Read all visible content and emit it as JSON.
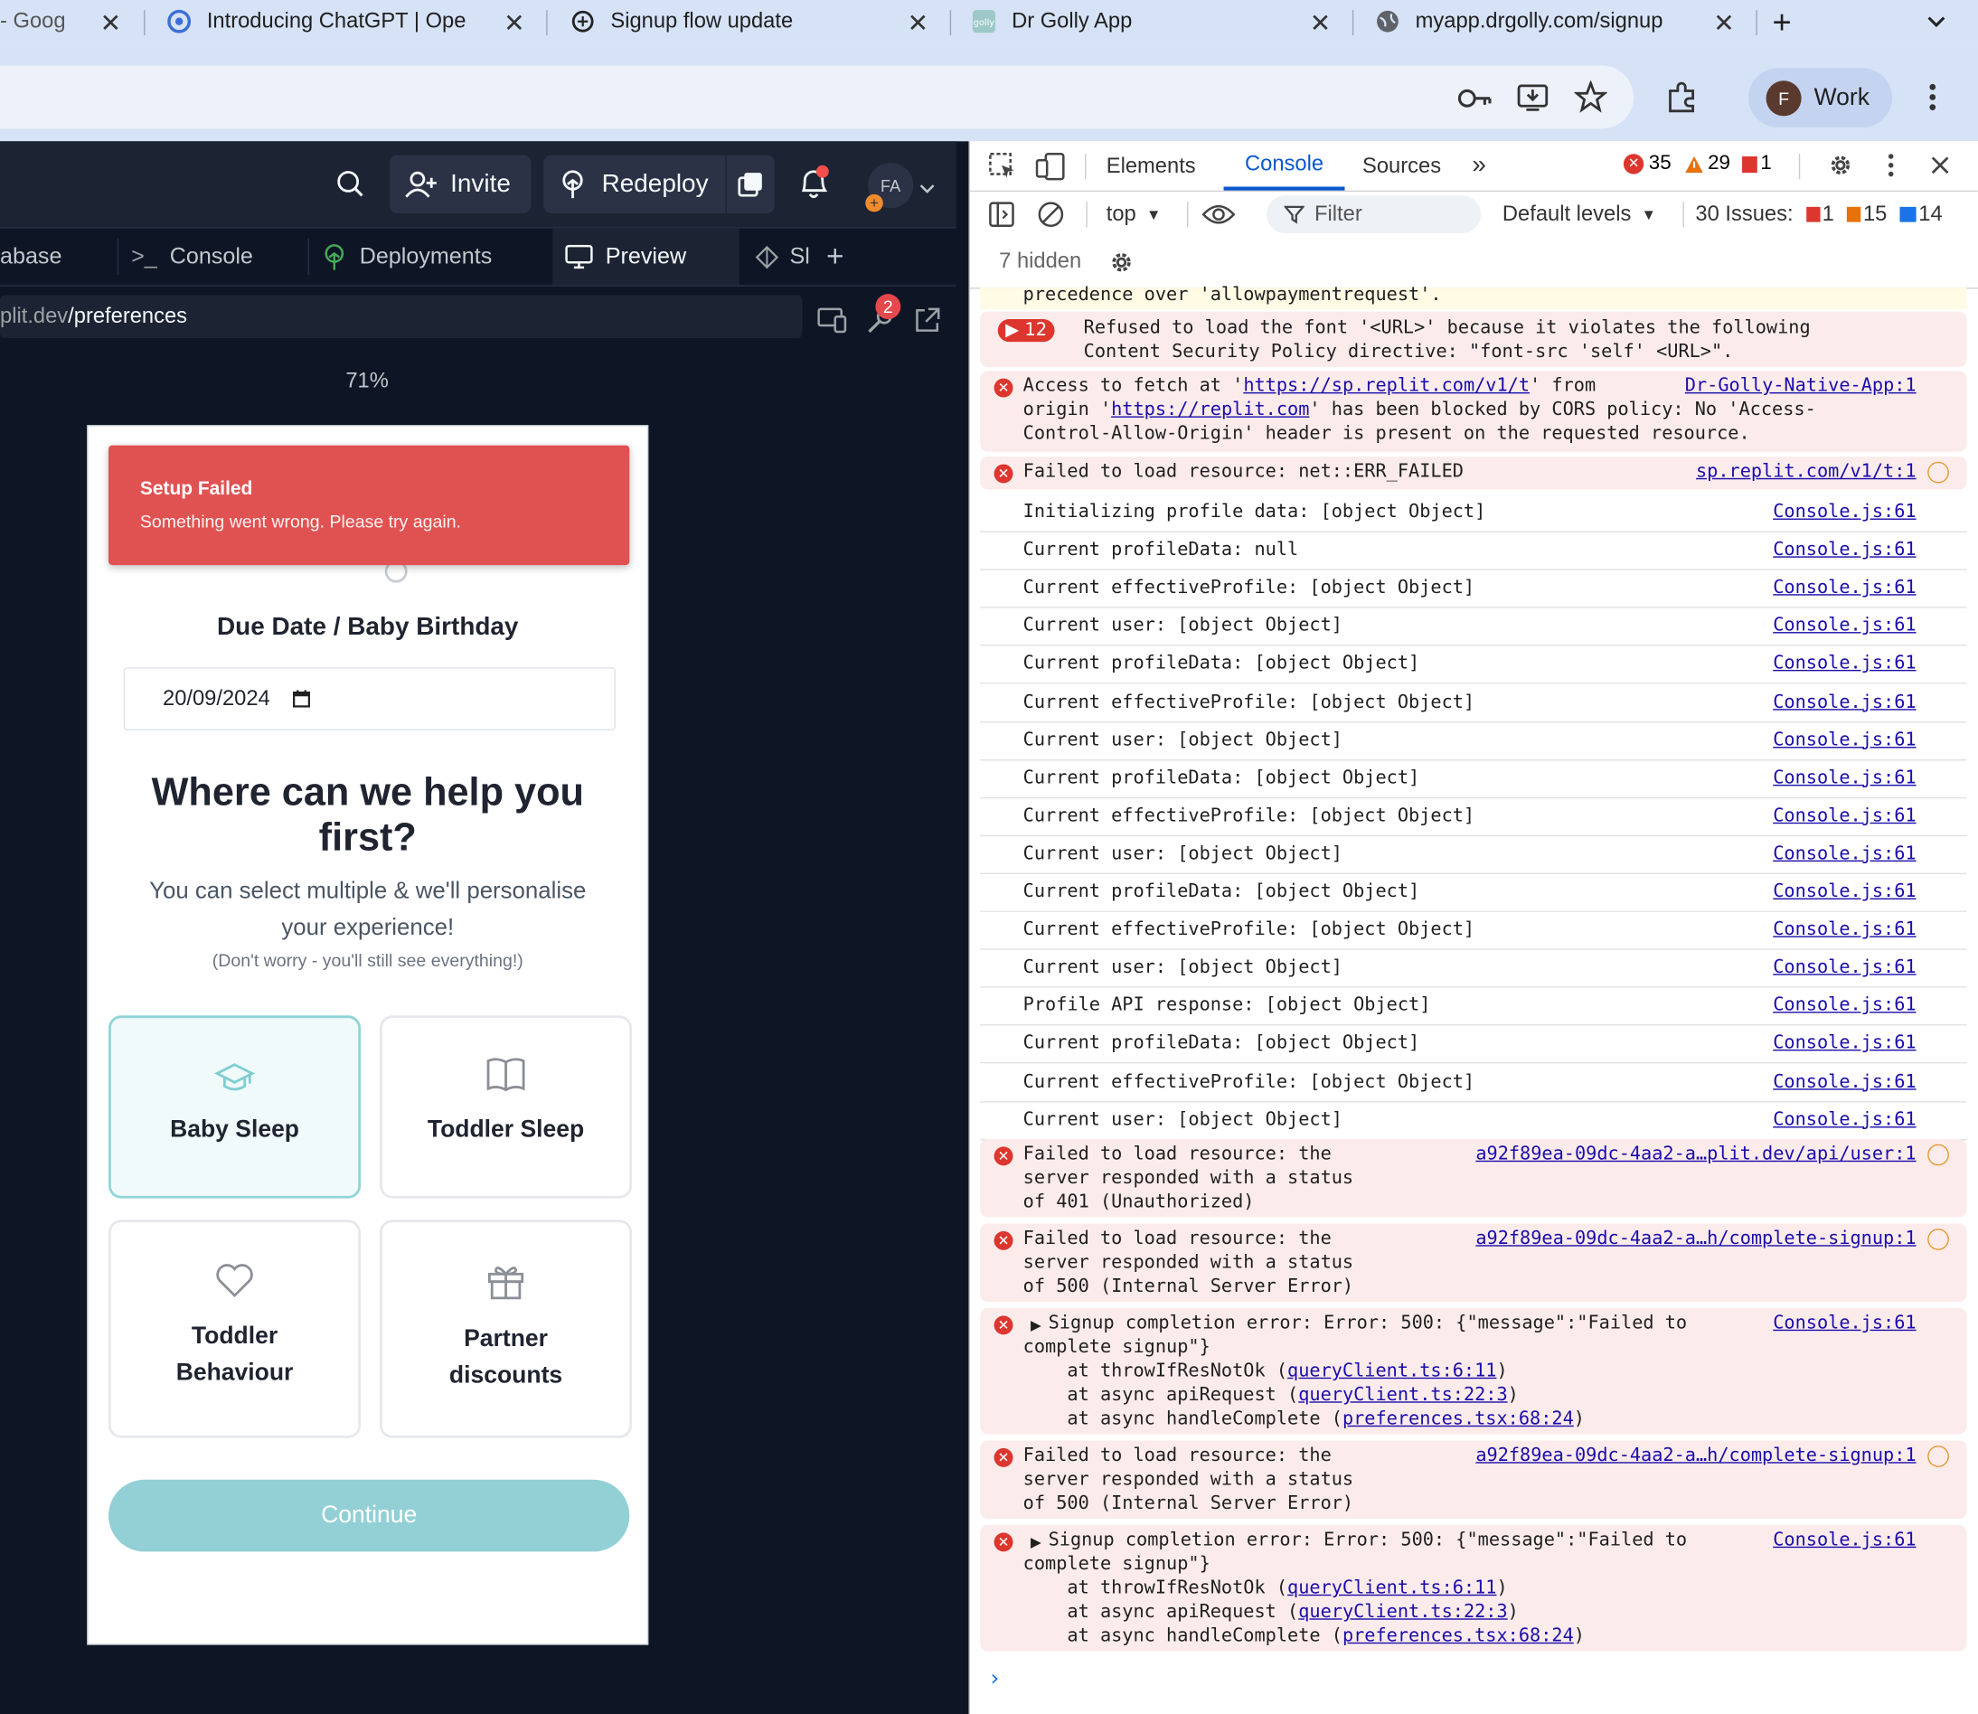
{
  "browser": {
    "tabs": [
      {
        "title": "- Goog",
        "icon": "google-icon"
      },
      {
        "title": "Introducing ChatGPT | Ope",
        "icon": "openai-icon"
      },
      {
        "title": "Signup flow update",
        "icon": "chatgpt-icon"
      },
      {
        "title": "Dr Golly App",
        "icon": "drgolly-icon"
      },
      {
        "title": "myapp.drgolly.com/signup",
        "icon": "globe-icon"
      }
    ],
    "profile": {
      "initial": "F",
      "label": "Work"
    }
  },
  "replit": {
    "header": {
      "invite": "Invite",
      "redeploy": "Redeploy",
      "avatar": "FA"
    },
    "tabs": [
      {
        "label": "abase"
      },
      {
        "label": "Console",
        "prefix": ">_"
      },
      {
        "label": "Deployments"
      },
      {
        "label": "Preview"
      },
      {
        "label": "Sl"
      }
    ],
    "url_host": "plit.dev",
    "url_path": "/preferences",
    "wrench_badge": "2",
    "zoom": "71%"
  },
  "preview": {
    "toast": {
      "title": "Setup Failed",
      "message": "Something went wrong. Please try again."
    },
    "due_label": "Due Date / Baby Birthday",
    "date_value": "20/09/2024",
    "heading_1": "Where can we help you",
    "heading_2": "first?",
    "subtitle_1": "You can select multiple & we'll personalise",
    "subtitle_2": "your experience!",
    "note": "(Don't worry - you'll still see everything!)",
    "options": [
      {
        "label": "Baby Sleep",
        "icon": "graduation-cap-icon",
        "selected": true
      },
      {
        "label": "Toddler Sleep",
        "icon": "book-icon",
        "selected": false
      },
      {
        "label_1": "Toddler",
        "label_2": "Behaviour",
        "icon": "heart-icon",
        "selected": false
      },
      {
        "label_1": "Partner",
        "label_2": "discounts",
        "icon": "gift-icon",
        "selected": false
      }
    ],
    "continue": "Continue",
    "accent": "#92d0d6",
    "error_color": "#e05252"
  },
  "devtools": {
    "tabs": [
      "Elements",
      "Console",
      "Sources"
    ],
    "errors": "35",
    "warnings": "29",
    "issues_badge": "1",
    "context": "top",
    "filter_placeholder": "Filter",
    "levels": "Default levels",
    "issues_label": "30 Issues:",
    "issues_err": "1",
    "issues_warn": "15",
    "issues_info": "14",
    "hidden": "7 hidden",
    "log": {
      "precedence": "precedence over 'allowpaymentrequest'.",
      "font_count": "12",
      "font_1": "Refused to load the font '<URL>' because it violates the following",
      "font_2": "Content Security Policy directive: \"font-src 'self' <URL>\".",
      "cors_a": "Access to fetch at '",
      "cors_url": "https://sp.replit.com/v1/t",
      "cors_b": "' from",
      "cors_src": "Dr-Golly-Native-App:1",
      "cors_c": "origin '",
      "cors_origin": "https://replit.com",
      "cors_d": "' has been blocked by CORS policy: No 'Access-",
      "cors_e": "Control-Allow-Origin' header is present on the requested resource.",
      "failed_1": "Failed to load resource: net::ERR_FAILED",
      "failed_1_src": "sp.replit.com/v1/t:1",
      "plain": [
        "Initializing profile data: [object Object]",
        "Current profileData: null",
        "Current effectiveProfile: [object Object]",
        "Current user: [object Object]",
        "Current profileData: [object Object]",
        "Current effectiveProfile: [object Object]",
        "Current user: [object Object]",
        "Current profileData: [object Object]",
        "Current effectiveProfile: [object Object]",
        "Current user: [object Object]",
        "Current profileData: [object Object]",
        "Current effectiveProfile: [object Object]",
        "Current user: [object Object]",
        "Profile API response: [object Object]",
        "Current profileData: [object Object]",
        "Current effectiveProfile: [object Object]",
        "Current user: [object Object]"
      ],
      "console_src": "Console.js:61",
      "e401_1": "Failed to load resource: the",
      "e401_2": "server responded with a status",
      "e401_3": "of 401 (Unauthorized)",
      "e401_src": "a92f89ea-09dc-4aa2-a…plit.dev/api/user:1",
      "e500_1": "Failed to load resource: the",
      "e500_2": "server responded with a status",
      "e500_3": "of 500 (Internal Server Error)",
      "e500_src": "a92f89ea-09dc-4aa2-a…h/complete-signup:1",
      "sig_1": "Signup completion error: Error: 500: {\"message\":\"Failed to",
      "sig_2": "complete signup\"}",
      "sig_3a": "    at throwIfResNotOk (",
      "sig_3l": "queryClient.ts:6:11",
      "sig_4a": "    at async apiRequest (",
      "sig_4l": "queryClient.ts:22:3",
      "sig_5a": "    at async handleComplete (",
      "sig_5l": "preferences.tsx:68:24",
      "close_paren": ")"
    }
  }
}
